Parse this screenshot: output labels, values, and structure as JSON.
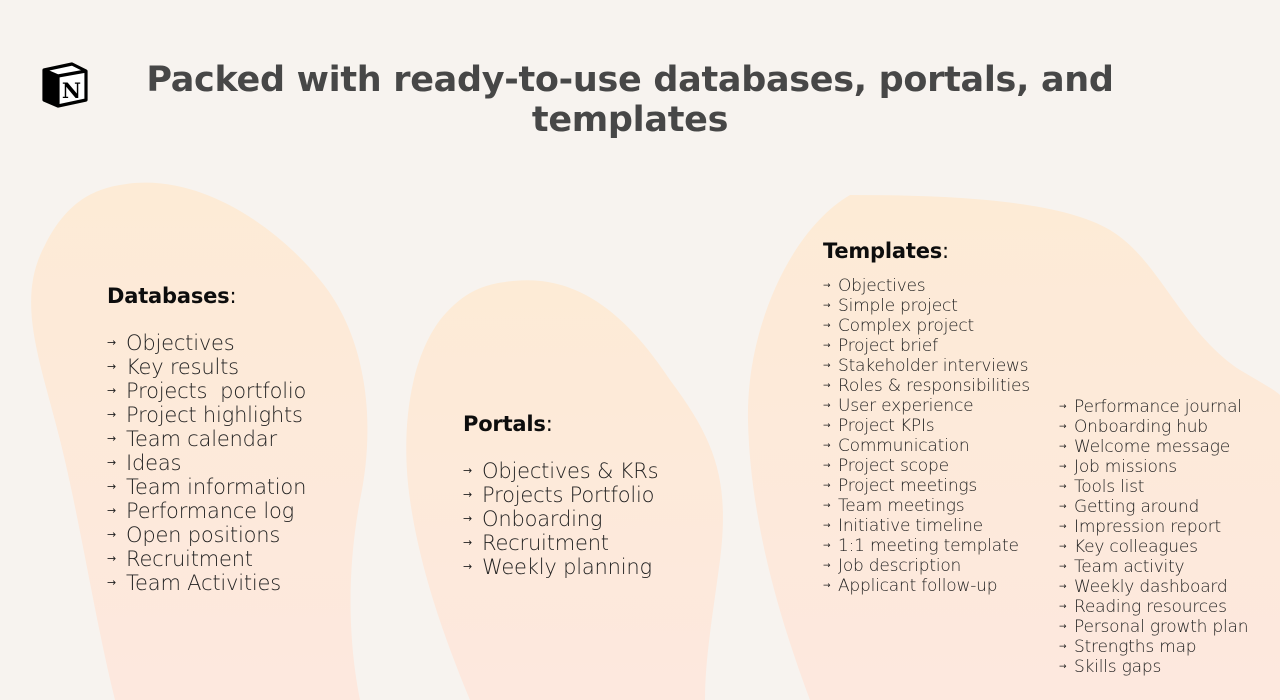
{
  "colors": {
    "background": "#f7f3ef",
    "blob_top": "#fdebd8",
    "blob_bottom": "#fde8dd",
    "title": "#474747",
    "text": "#1a1a1a"
  },
  "logo": {
    "icon": "notion-logo-icon",
    "letter": "N"
  },
  "title": "Packed with ready-to-use databases, portals, and templates",
  "list_bullet": "→",
  "databases": {
    "heading": "Databases",
    "colon": ":",
    "items": [
      "Objectives",
      "Key results",
      "Projects  portfolio",
      "Project highlights",
      "Team calendar",
      "Ideas",
      "Team information",
      "Performance log",
      "Open positions",
      "Recruitment",
      "Team Activities"
    ]
  },
  "portals": {
    "heading": "Portals",
    "colon": ":",
    "items": [
      "Objectives & KRs",
      "Projects Portfolio",
      "Onboarding",
      "Recruitment",
      "Weekly planning"
    ]
  },
  "templates": {
    "heading": "Templates",
    "colon": ":",
    "column1": [
      "Objectives",
      "Simple project",
      "Complex project",
      "Project brief",
      "Stakeholder interviews",
      "Roles & responsibilities",
      "User experience",
      "Project KPIs",
      "Communication",
      "Project scope",
      "Project meetings",
      "Team meetings",
      "Initiative timeline",
      "1:1 meeting template",
      "Job description",
      "Applicant follow-up"
    ],
    "column2": [
      "Performance journal",
      "Onboarding hub",
      "Welcome message",
      "Job missions",
      "Tools list",
      "Getting around",
      "Impression report",
      "Key colleagues",
      "Team activity",
      "Weekly dashboard",
      "Reading resources",
      "Personal growth plan",
      "Strengths map",
      "Skills gaps"
    ]
  }
}
